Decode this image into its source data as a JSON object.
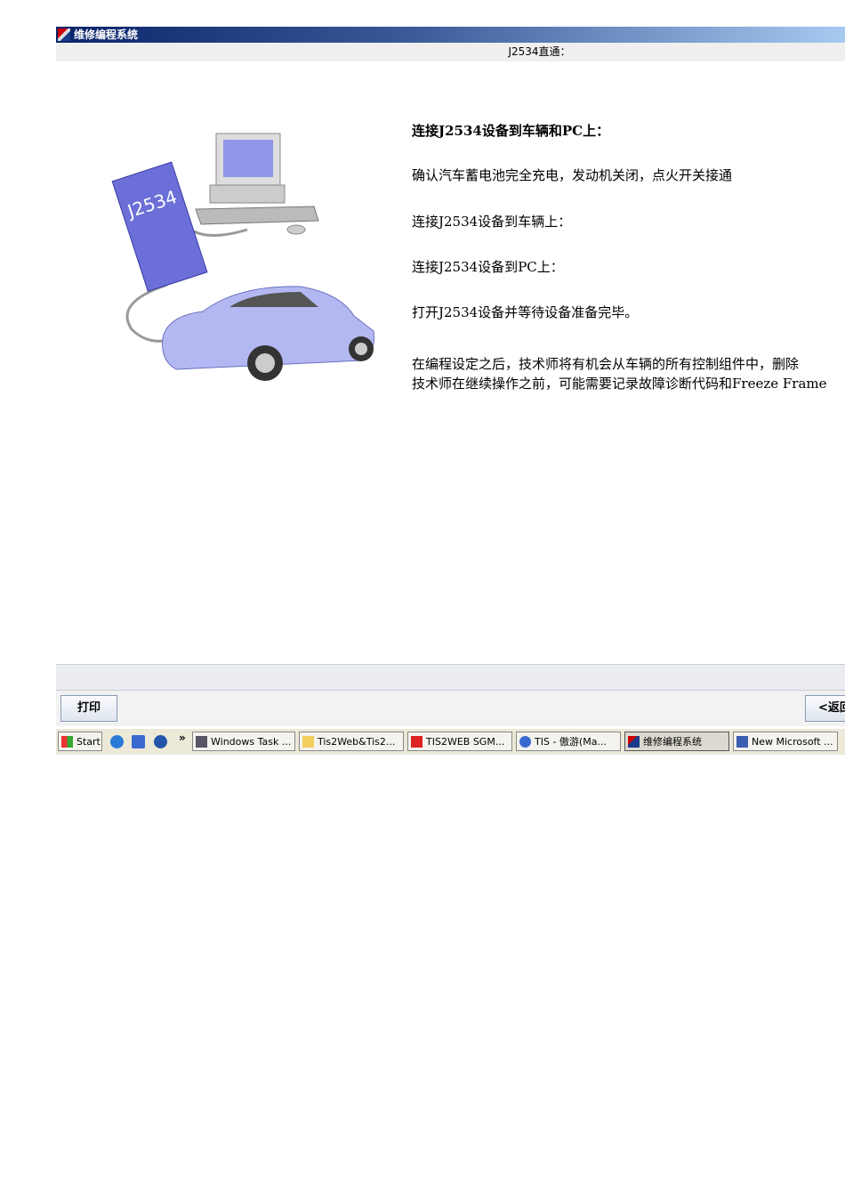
{
  "window": {
    "title": "维修编程系统"
  },
  "header": {
    "subtitle": "J2534直通："
  },
  "illustration": {
    "device_label": "J2534"
  },
  "content": {
    "heading": "连接J2534设备到车辆和PC上：",
    "steps": [
      "确认汽车蓄电池完全充电，发动机关闭，点火开关接通",
      "连接J2534设备到车辆上：",
      "连接J2534设备到PC上：",
      "打开J2534设备并等待设备准备完毕。"
    ],
    "note_line1": "在编程设定之后，技术师将有机会从车辆的所有控制组件中，删除",
    "note_line2": "技术师在继续操作之前，可能需要记录故障诊断代码和Freeze Frame"
  },
  "buttons": {
    "print": "打印",
    "back": "<返回"
  },
  "taskbar": {
    "start": "Start",
    "chevron": "»",
    "items": [
      {
        "label": "Windows Task ...",
        "icon": "monitor-icon"
      },
      {
        "label": "Tis2Web&Tis2...",
        "icon": "folder-icon"
      },
      {
        "label": "TIS2WEB SGM...",
        "icon": "pdf-icon"
      },
      {
        "label": "TIS - 傲游(Ma...",
        "icon": "browser-icon"
      },
      {
        "label": "维修编程系统",
        "icon": "app-icon"
      },
      {
        "label": "New Microsoft ...",
        "icon": "word-icon"
      }
    ]
  }
}
